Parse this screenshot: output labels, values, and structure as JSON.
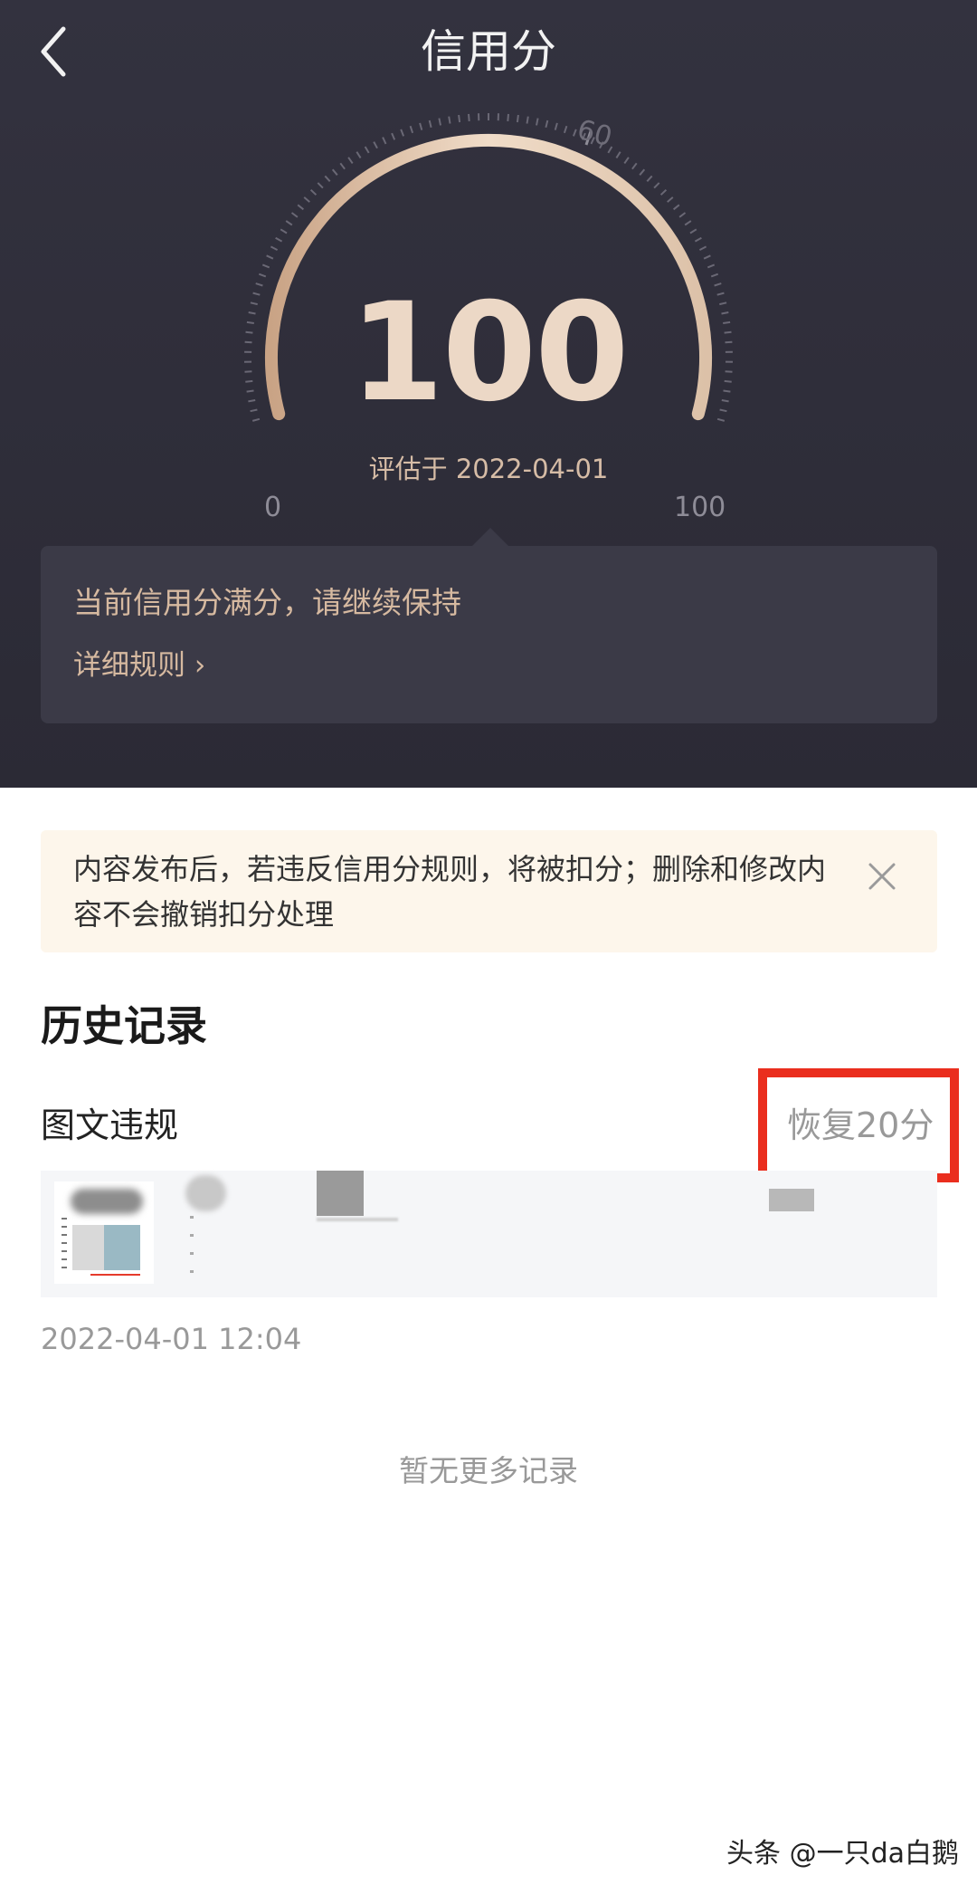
{
  "header": {
    "title": "信用分",
    "back_icon": "chevron-left-icon"
  },
  "gauge": {
    "score": "100",
    "eval_date": "评估于 2022-04-01",
    "tick_min": "0",
    "tick_max": "100",
    "tick_mark": "60",
    "score_fraction": 1.0,
    "arc_color": "#d9b89a"
  },
  "status": {
    "message": "当前信用分满分，请继续保持",
    "rules_link": "详细规则 ›"
  },
  "notice": {
    "text": "内容发布后，若违反信用分规则，将被扣分；删除和修改内容不会撤销扣分处理",
    "close_icon": "close-icon"
  },
  "history": {
    "title": "历史记录",
    "records": [
      {
        "type": "图文违规",
        "change": "恢复20分",
        "time": "2022-04-01 12:04"
      }
    ],
    "empty_text": "暂无更多记录"
  },
  "watermark": "头条 @一只da白鹅",
  "colors": {
    "header_bg": "#2e2d38",
    "card_bg": "#3b3a47",
    "gold_text": "#d6b9a0",
    "notice_bg": "#fdf6eb",
    "highlight_red": "#ea2e1e"
  }
}
